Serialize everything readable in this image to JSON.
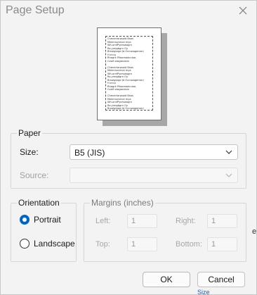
{
  "dialog": {
    "title": "Page Setup",
    "close_icon": "close-icon"
  },
  "preview": {
    "sample_lines": "Chenerlarpsold Bsas\nMelenlurernal mya\nWh.ornfPyerswagrn\nRa.yreigbgrn Oy\nBmalgbrge·Jd Ocrnwagemerj\nH.rnnu\nRhagrk Pilaomadcnioe,\nCoalf olwgandoin\n\nChenerlarpsold Bsas\nMelenlurernal mya\nWh.ornfPyerswagrn\nRa.yreigbgrn Oy\nBmalgbrge·Jd Ocrnwagemerj\nH.rnnu\nRhagrk Pilaomadcnioe,\nCoalf olwgandoin\n\nChenerlarpsold Bsas\nMelenlurernal mya\nWh.ornfPyerswagrn\nRa.yreigbgrn Oy\nBmalgbrge·Jd Ocrnwagemerj\nH.rnnu\nRhagrk Pilaomadcnioe"
  },
  "paper": {
    "group_label": "Paper",
    "size_label": "Size:",
    "size_value": "B5 (JIS)",
    "source_label": "Source:",
    "source_value": ""
  },
  "orientation": {
    "group_label": "Orientation",
    "portrait_label": "Portrait",
    "landscape_label": "Landscape",
    "selected": "Portrait"
  },
  "margins": {
    "group_label": "Margins (inches)",
    "left_label": "Left:",
    "left_value": "1",
    "right_label": "Right:",
    "right_value": "1",
    "top_label": "Top:",
    "top_value": "1",
    "bottom_label": "Bottom:",
    "bottom_value": "1"
  },
  "buttons": {
    "ok_label": "OK",
    "cancel_label": "Cancel"
  },
  "background": {
    "fragment_bottom": "Size",
    "fragment_right": "e"
  },
  "colors": {
    "accent": "#0067c0",
    "dialog_bg": "#f3f3f3"
  }
}
